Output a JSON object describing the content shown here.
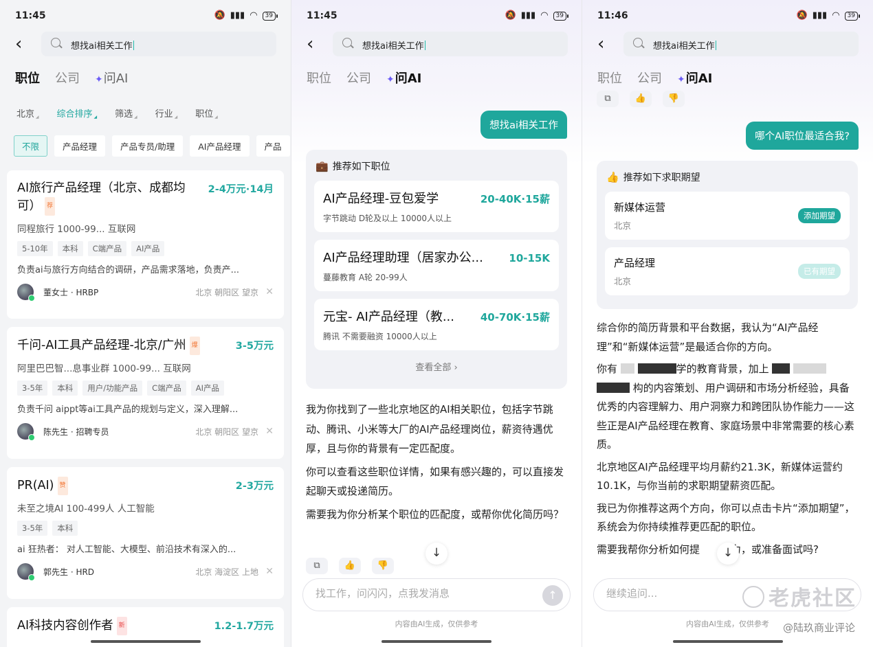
{
  "panel1": {
    "time": "11:45",
    "battery": "39",
    "search_query": "想找ai相关工作",
    "tabs": [
      "职位",
      "公司",
      "问AI"
    ],
    "filters": [
      "北京",
      "综合排序",
      "筛选",
      "行业",
      "职位"
    ],
    "chips": [
      "不限",
      "产品经理",
      "产品专员/助理",
      "AI产品经理",
      "产品"
    ],
    "jobs": [
      {
        "title": "AI旅行产品经理（北京、成都均可）",
        "badge": "荐",
        "salary": "2-4万元·14月",
        "company": "同程旅行  1000-99...  互联网",
        "tags": [
          "5-10年",
          "本科",
          "C端产品",
          "AI产品"
        ],
        "desc": "负责ai与旅行方向结合的调研，产品需求落地，负责产...",
        "recruiter": "董女士 · HRBP",
        "location": "北京  朝阳区  望京"
      },
      {
        "title": "千问-AI工具产品经理-北京/广州",
        "badge": "爆",
        "salary": "3-5万元",
        "company": "阿里巴巴智...息事业群    1000-99...  互联网",
        "tags": [
          "3-5年",
          "本科",
          "用户/功能产品",
          "C端产品",
          "AI产品"
        ],
        "desc": "负责千问 aippt等ai工具产品的规划与定义，深入理解...",
        "recruiter": "陈先生 · 招聘专员",
        "location": "北京  朝阳区  望京"
      },
      {
        "title": "PR(AI)",
        "badge": "赞",
        "salary": "2-3万元",
        "company": "未至之境AI  100-499人  人工智能",
        "tags": [
          "3-5年",
          "本科"
        ],
        "desc": "ai 狂热者：  对人工智能、大模型、前沿技术有深入的...",
        "recruiter": "郭先生 · HRD",
        "location": "北京  海淀区  上地"
      },
      {
        "title": "AI科技内容创作者",
        "badge": "新",
        "salary": "1.2-1.7万元"
      }
    ]
  },
  "panel2": {
    "time": "11:45",
    "battery": "39",
    "search_query": "想找ai相关工作",
    "tabs": [
      "职位",
      "公司",
      "问AI"
    ],
    "user_msg": "想找ai相关工作",
    "reco_header": "推荐如下职位",
    "reco_jobs": [
      {
        "title": "AI产品经理-豆包爱学",
        "salary": "20-40K·15薪",
        "sub": "字节跳动  D轮及以上  10000人以上"
      },
      {
        "title": "AI产品经理助理（居家办公...",
        "salary": "10-15K",
        "sub": "蔓藤教育  A轮  20-99人"
      },
      {
        "title": "元宝- AI产品经理（教...",
        "salary": "40-70K·15薪",
        "sub": "腾讯  不需要融资  10000人以上"
      }
    ],
    "see_all": "查看全部",
    "paragraphs": [
      "我为你找到了一些北京地区的AI相关职位，包括字节跳动、腾讯、小米等大厂的AI产品经理岗位，薪资待遇优厚，且与你的背景有一定匹配度。",
      "你可以查看这些职位详情，如果有感兴趣的，可以直接发起聊天或投递简历。",
      "需要我为你分析某个职位的匹配度，或帮你优化简历吗？"
    ],
    "input_placeholder": "找工作，问闪闪，点我发消息",
    "disclaimer": "内容由AI生成，仅供参考"
  },
  "panel3": {
    "time": "11:46",
    "battery": "39",
    "search_query": "想找ai相关工作",
    "tabs": [
      "职位",
      "公司",
      "问AI"
    ],
    "user_msg": "哪个AI职位最适合我?",
    "reco_header": "推荐如下求职期望",
    "expectations": [
      {
        "title": "新媒体运营",
        "city": "北京",
        "button": "添加期望"
      },
      {
        "title": "产品经理",
        "city": "北京",
        "button": "已有期望"
      }
    ],
    "p1": "综合你的简历背景和平台数据，我认为“AI产品经理”和“新媒体运营”是最适合你的方向。",
    "p2_a": "你有",
    "p2_b": "学的教育背景，加上",
    "p2_c": "构的内容策划、用户调研和市场分析经验，具备优秀的内容理解力、用户洞察力和跨团队协作能力——这些正是AI产品经理在教育、家庭场景中非常需要的核心素质。",
    "p3": "北京地区AI产品经理平均月薪约21.3K，新媒体运营约10.1K，与你当前的求职期望薪资匹配。",
    "p4": "我已为你推荐这两个方向，你可以点击卡片“添加期望”，系统会为你持续推荐更匹配的职位。",
    "p5_a": "需要我帮你分析如何提",
    "p5_b": "争力，或准备面试吗?",
    "input_placeholder": "继续追问...",
    "disclaimer": "内容由AI生成，仅供参考",
    "watermark": "老虎社区",
    "watermark2": "@陆玖商业评论"
  },
  "colors": {
    "accent": "#1fa79c",
    "ai_star": "#6b5cf6",
    "salary": "#22a8a0"
  }
}
